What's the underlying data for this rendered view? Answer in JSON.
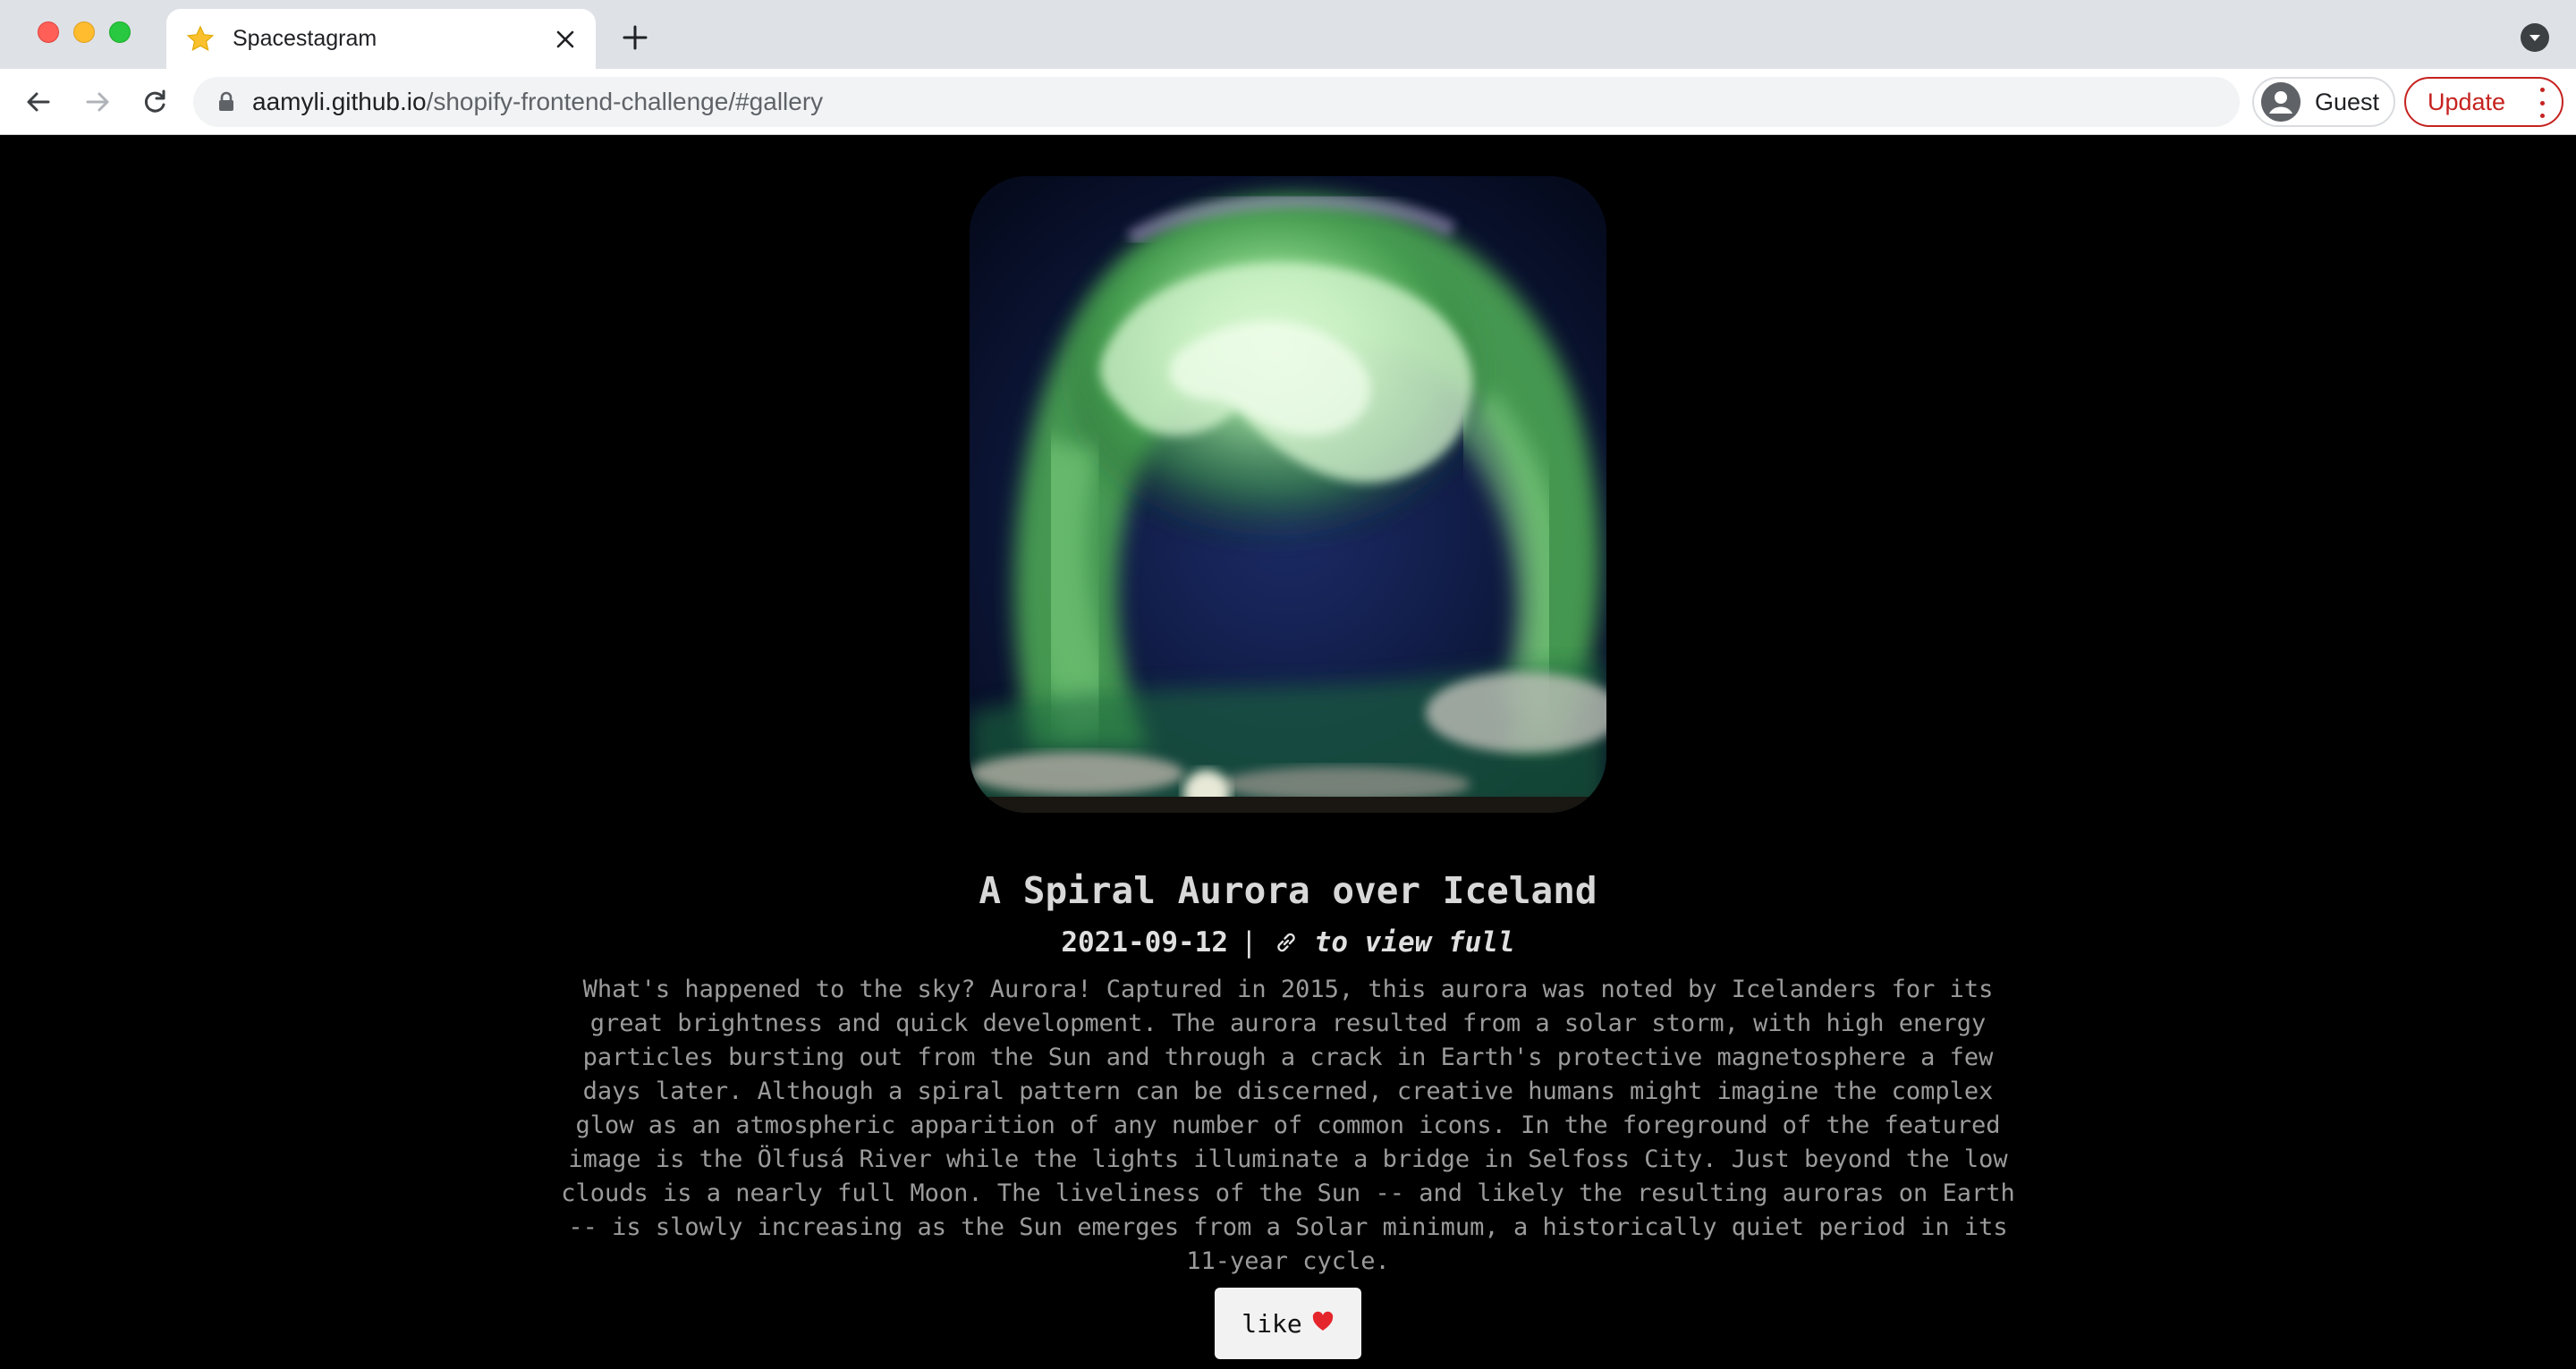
{
  "browser": {
    "tab": {
      "title": "Spacestagram",
      "favicon": "star-icon"
    },
    "url": {
      "host": "aamyli.github.io",
      "path": "/shopify-frontend-challenge/#gallery"
    },
    "profile": {
      "label": "Guest",
      "icon": "person-icon"
    },
    "update": {
      "label": "Update"
    }
  },
  "post": {
    "title": "A Spiral Aurora over Iceland",
    "date": "2021-09-12",
    "separator": "|",
    "link_icon": "link-icon",
    "link_text": "to view full",
    "explanation": "What's happened to the sky? Aurora! Captured in 2015, this aurora was noted by Icelanders for its great brightness and quick development. The aurora resulted from a solar storm, with high energy particles bursting out from the Sun and through a crack in Earth's protective magnetosphere a few days later. Although a spiral pattern can be discerned, creative humans might imagine the complex glow as an atmospheric apparition of any number of common icons. In the foreground of the featured image is the Ölfusá River while the lights illuminate a bridge in Selfoss City. Just beyond the low clouds is a nearly full Moon. The liveliness of the Sun -- and likely the resulting auroras on Earth -- is slowly increasing as the Sun emerges from a Solar minimum, a historically quiet period in its 11-year cycle.",
    "like_label": "like",
    "like_icon": "heart-icon"
  },
  "colors": {
    "page_background": "#000000",
    "aurora_green": "#7fd67a",
    "update_red": "#c5221f"
  }
}
